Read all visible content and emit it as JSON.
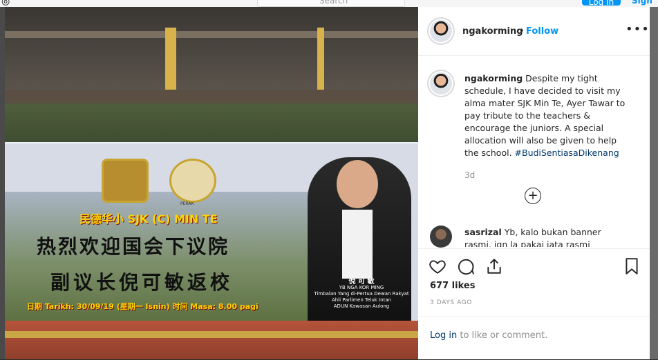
{
  "backdrop": {
    "search_placeholder": "Search",
    "login_label": "Log In",
    "signup_label": "Sign"
  },
  "banner": {
    "crest_label": "PERAK",
    "school_title": "民德华小 SJK (C) MIN TE",
    "slogan_line1": "热烈欢迎国会下议院",
    "slogan_line2": "副议长倪可敏返校",
    "date_line": "日期 Tarikh: 30/09/19 (星期一 Isnin)   时间 Masa: 8.00 pagi",
    "person_name_cn": "倪 可 敏",
    "person_name": "YB NGA KOR MING",
    "person_title1": "Timbalan Yang di-Pertua Dewan Rakyat",
    "person_title2": "Ahli Parlimen Teluk Intan",
    "person_title3": "ADUN Kawasan Aulong"
  },
  "post": {
    "username": "ngakorming",
    "separator": "•",
    "follow_label": "Follow",
    "more_label": "•••",
    "caption_username": "ngakorming",
    "caption_text": "Despite my tight schedule, I have decided to visit my alma mater SJK Min Te, Ayer Tawar to pay tribute to the teachers & encourage the juniors. A special allocation will also be given to help the school.",
    "caption_hashtag": "#BudiSentiasaDikenang",
    "age": "3d",
    "load_more_label": "+",
    "comment_username": "sasrizal",
    "comment_text": "Yb, kalo bukan banner rasmi, jgn la pakai jata rasmi kerajaan.. Jika",
    "likes": "677 likes",
    "posted_ago": "3 DAYS AGO",
    "login_link": "Log in",
    "login_suffix": "to like or comment."
  }
}
